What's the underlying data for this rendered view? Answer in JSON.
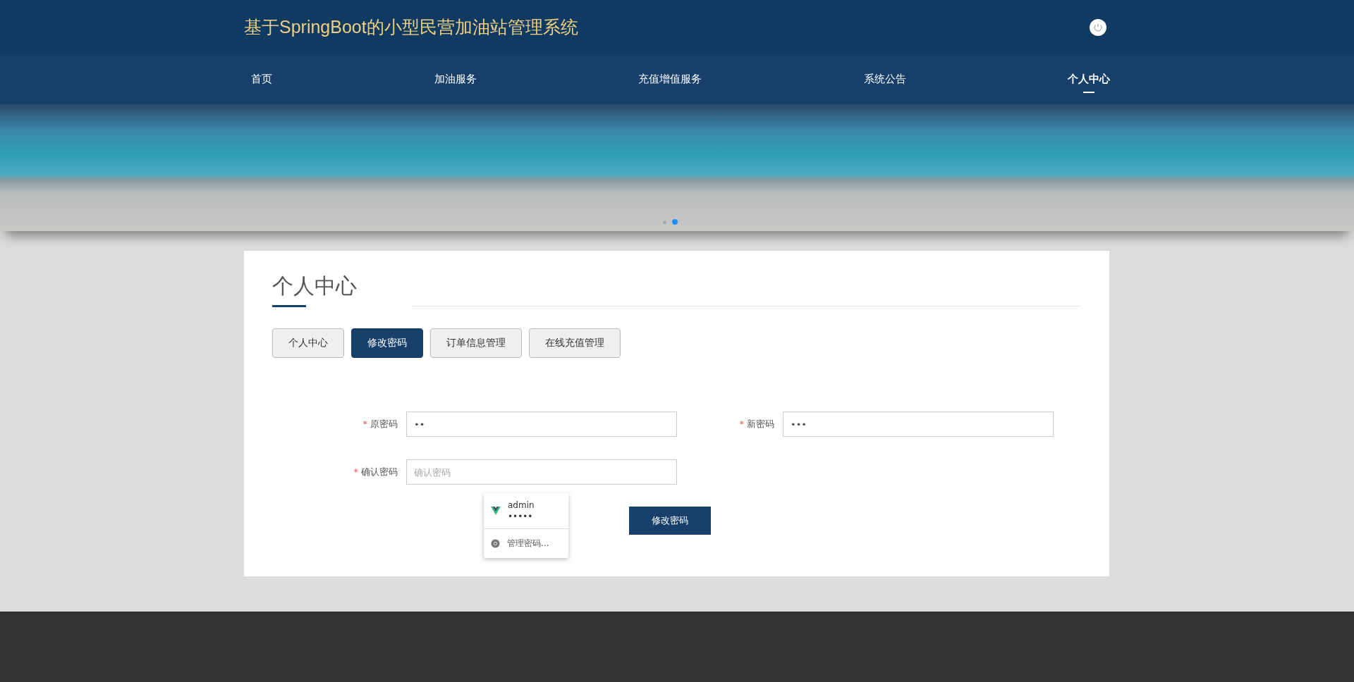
{
  "header": {
    "title": "基于SpringBoot的小型民营加油站管理系统"
  },
  "nav": [
    {
      "label": "首页",
      "selected": false
    },
    {
      "label": "加油服务",
      "selected": false
    },
    {
      "label": "充值增值服务",
      "selected": false
    },
    {
      "label": "系统公告",
      "selected": false
    },
    {
      "label": "个人中心",
      "selected": true
    }
  ],
  "banner": {
    "dots": [
      {
        "selected": false
      },
      {
        "selected": true
      }
    ]
  },
  "panel": {
    "title": "个人中心",
    "tabs": [
      {
        "label": "个人中心",
        "selected": false
      },
      {
        "label": "修改密码",
        "selected": true
      },
      {
        "label": "订单信息管理",
        "selected": false
      },
      {
        "label": "在线充值管理",
        "selected": false
      }
    ],
    "fields": [
      {
        "label": "原密码",
        "marker": "*",
        "value": "••"
      },
      {
        "label": "新密码",
        "marker": "*",
        "value": "•••"
      },
      {
        "label": "确认密码",
        "marker": "*",
        "placeholder": "确认密码"
      }
    ],
    "submit": "修改密码"
  },
  "autofill": {
    "entries": [
      {
        "username": "admin",
        "password": "•••••"
      }
    ],
    "manage": "管理密码..."
  }
}
